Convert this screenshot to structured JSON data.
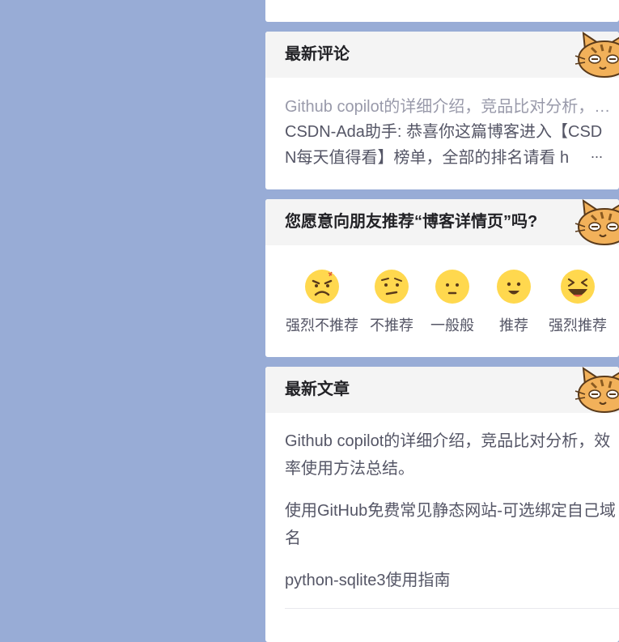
{
  "comments_card": {
    "title": "最新评论",
    "article_link": "Github copilot的详细介绍，竞品比对分析，效率使用方法总结。",
    "comment_author": "CSDN-Ada助手",
    "comment_text": "CSDN-Ada助手: 恭喜你这篇博客进入【CSDN每天值得看】榜单，全部的排名请看 h",
    "ellipsis": "..."
  },
  "recommend_card": {
    "title": "您愿意向朋友推荐“博客详情页”吗?",
    "options": [
      {
        "label": "强烈不推荐",
        "icon": "angry-face-icon"
      },
      {
        "label": "不推荐",
        "icon": "skeptical-face-icon"
      },
      {
        "label": "一般般",
        "icon": "neutral-face-icon"
      },
      {
        "label": "推荐",
        "icon": "smile-face-icon"
      },
      {
        "label": "强烈推荐",
        "icon": "laughing-face-icon"
      }
    ]
  },
  "articles_card": {
    "title": "最新文章",
    "items": [
      "Github copilot的详细介绍，竞品比对分析，效率使用方法总结。",
      "使用GitHub免费常见静态网站-可选绑定自己域名",
      "python-sqlite3使用指南"
    ]
  },
  "colors": {
    "page_background": "#98acd6",
    "card_header": "#f4f4f4",
    "emoji_yellow": "#ffd84e"
  }
}
